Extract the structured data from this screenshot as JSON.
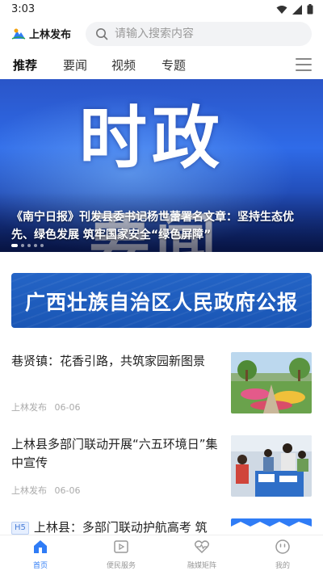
{
  "status": {
    "time": "3:03"
  },
  "header": {
    "logo_text": "上林发布",
    "search_placeholder": "请输入搜索内容"
  },
  "tabs": [
    {
      "label": "推荐",
      "active": true
    },
    {
      "label": "要闻",
      "active": false
    },
    {
      "label": "视频",
      "active": false
    },
    {
      "label": "专题",
      "active": false
    }
  ],
  "banner": {
    "image_text_top": "时政",
    "image_text_bottom": "要闻",
    "caption": "《南宁日报》刊发县委书记杨世蕾署名文章：坚持生态优先、绿色发展 筑牢国家安全“绿色屏障”",
    "dots_count": 5,
    "active_dot": 0
  },
  "gazette_banner": {
    "text": "广西壮族自治区人民政府公报"
  },
  "news": [
    {
      "title": "巷贤镇：花香引路，共筑家园新图景",
      "source": "上林发布",
      "date": "06-06",
      "badge": ""
    },
    {
      "title": "上林县多部门联动开展“六五环境日”集中宣传",
      "source": "上林发布",
      "date": "06-06",
      "badge": ""
    },
    {
      "title": "上林县：多部门联动护航高考 筑",
      "source": "",
      "date": "",
      "badge": "H5"
    }
  ],
  "bottom_nav": [
    {
      "label": "首页",
      "icon": "home-icon",
      "active": true
    },
    {
      "label": "便民服务",
      "icon": "play-square-icon",
      "active": false
    },
    {
      "label": "融媒矩阵",
      "icon": "heart-pulse-icon",
      "active": false
    },
    {
      "label": "我的",
      "icon": "smile-face-icon",
      "active": false
    }
  ],
  "colors": {
    "accent": "#2f7cf6",
    "banner_blue": "#2f6be8",
    "gazette_blue": "#1a56b5"
  }
}
